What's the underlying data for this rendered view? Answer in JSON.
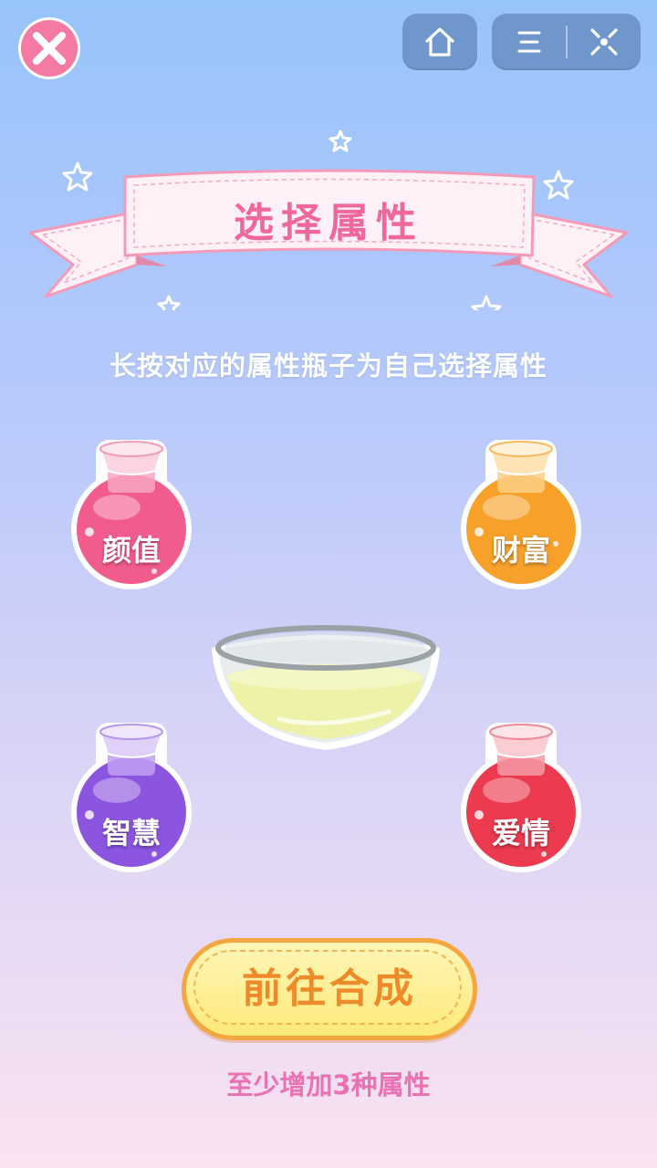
{
  "top_bar": {
    "close_icon": "close-x-icon",
    "home_icon": "home-icon",
    "menu_icon": "menu-icon",
    "exit_icon": "exit-target-icon"
  },
  "banner": {
    "title": "选择属性"
  },
  "instruction": "长按对应的属性瓶子为自己选择属性",
  "bottles": [
    {
      "label": "颜值",
      "color": "#f25c8c"
    },
    {
      "label": "财富",
      "color": "#f7a12b"
    },
    {
      "label": "智慧",
      "color": "#8c55e0"
    },
    {
      "label": "爱情",
      "color": "#ec3a4f"
    }
  ],
  "go_button": {
    "label": "前往合成"
  },
  "hint": "至少增加3种属性",
  "colors": {
    "accent_pink": "#f0689a",
    "button_orange": "#ee8a2a",
    "hint_pink": "#ea72b2",
    "top_button_blue": "#6f97cb"
  }
}
